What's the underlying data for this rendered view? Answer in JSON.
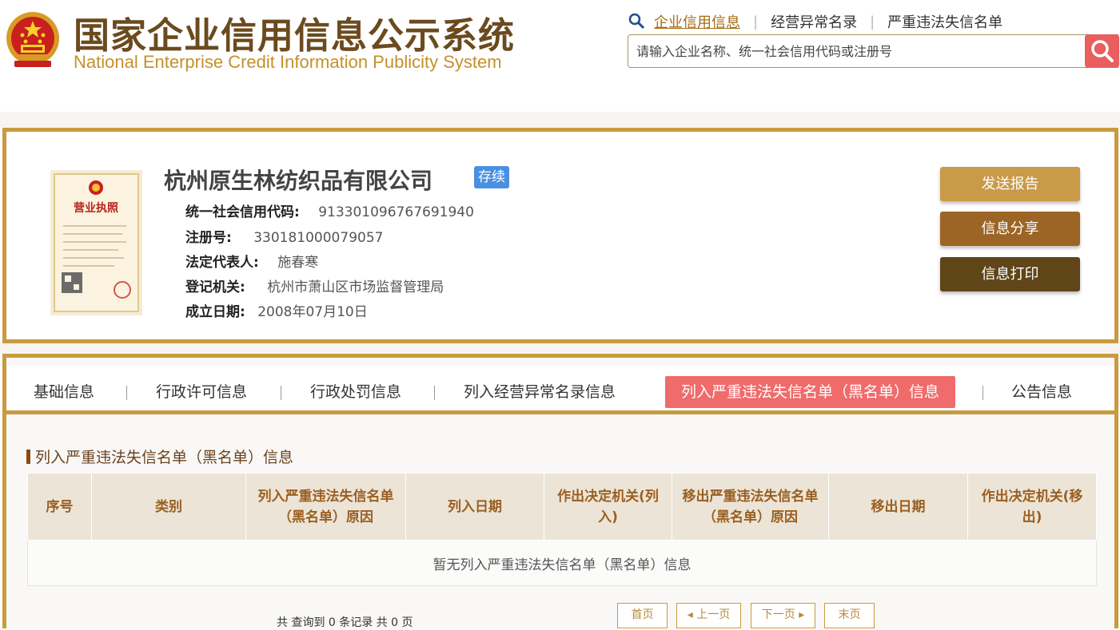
{
  "header": {
    "title_cn": "国家企业信用信息公示系统",
    "title_en": "National Enterprise Credit Information Publicity System",
    "emblem_icon": "national-emblem-icon",
    "nav": [
      {
        "label": "企业信用信息",
        "active": true
      },
      {
        "label": "经营异常名录",
        "active": false
      },
      {
        "label": "严重违法失信名单",
        "active": false
      }
    ],
    "nav_separator": "|",
    "search_placeholder": "请输入企业名称、统一社会信用代码或注册号",
    "search_icon": "search-icon"
  },
  "company": {
    "name": "杭州原生林纺织品有限公司",
    "status": "存续",
    "fields": [
      {
        "label": "统一社会信用代码:",
        "value": "913301096767691940"
      },
      {
        "label": "注册号:",
        "value": "330181000079057"
      },
      {
        "label": "法定代表人:",
        "value": "施春寒"
      },
      {
        "label": "登记机关:",
        "value": "杭州市萧山区市场监督管理局"
      },
      {
        "label": "成立日期:",
        "value": "2008年07月10日"
      }
    ],
    "license_icon": "business-license-icon",
    "license_text": "营业执照",
    "actions": [
      {
        "label": "发送报告",
        "color": "#c99a47"
      },
      {
        "label": "信息分享",
        "color": "#9c6425"
      },
      {
        "label": "信息打印",
        "color": "#5f4518"
      }
    ]
  },
  "tabs": [
    {
      "label": "基础信息",
      "active": false
    },
    {
      "label": "行政许可信息",
      "active": false
    },
    {
      "label": "行政处罚信息",
      "active": false
    },
    {
      "label": "列入经营异常名录信息",
      "active": false
    },
    {
      "label": "列入严重违法失信名单（黑名单）信息",
      "active": true
    },
    {
      "label": "公告信息",
      "active": false
    }
  ],
  "section": {
    "title": "列入严重违法失信名单（黑名单）信息",
    "columns": [
      "序号",
      "类别",
      "列入严重违法失信名单（黑名单）原因",
      "列入日期",
      "作出决定机关(列入)",
      "移出严重违法失信名单（黑名单）原因",
      "移出日期",
      "作出决定机关(移出)"
    ],
    "empty_text": "暂无列入严重违法失信名单（黑名单）信息"
  },
  "pager": {
    "summary": "共 查询到 0 条记录 共 0 页",
    "first": "首页",
    "prev": "上一页",
    "next": "下一页",
    "last": "末页"
  },
  "colors": {
    "gold_border": "#c99a3f",
    "active_tab": "#f06b6b",
    "status_badge": "#4a90e2",
    "search_button": "#e95e5e"
  }
}
